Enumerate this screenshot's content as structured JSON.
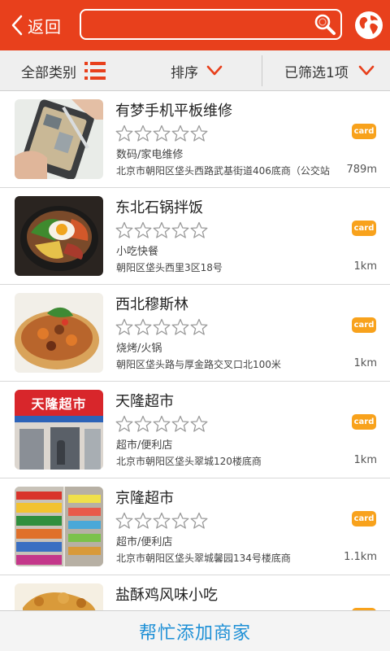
{
  "colors": {
    "brand": "#e8401c",
    "badge": "#f8a21c",
    "link": "#1e90d6"
  },
  "topbar": {
    "back_label": "返回",
    "search_placeholder": "",
    "search_value": "",
    "icons": {
      "back": "chevron-left-icon",
      "search": "search-icon",
      "globe": "globe-icon"
    }
  },
  "filters": {
    "all_categories": "全部类别",
    "sort": "排序",
    "selected": "已筛选1项",
    "icons": {
      "list": "list-icon",
      "dropdown": "chevron-down-icon"
    }
  },
  "items": [
    {
      "name": "有梦手机平板维修",
      "rating": 0,
      "category": "数码/家电维修",
      "address": "北京市朝阳区垡头西路武基街道406底商（公交站",
      "distance": "789m",
      "badge": "card",
      "thumb": "phone-repair"
    },
    {
      "name": "东北石锅拌饭",
      "rating": 0,
      "category": "小吃快餐",
      "address": "朝阳区垡头西里3区18号",
      "distance": "1km",
      "badge": "card",
      "thumb": "bibimbap"
    },
    {
      "name": "西北穆斯林",
      "rating": 0,
      "category": "烧烤/火锅",
      "address": "朝阳区垡头路与厚金路交叉口北100米",
      "distance": "1km",
      "badge": "card",
      "thumb": "pizza"
    },
    {
      "name": "天隆超市",
      "rating": 0,
      "category": "超市/便利店",
      "address": "北京市朝阳区垡头翠城120楼底商",
      "distance": "1km",
      "badge": "card",
      "thumb": "storefront",
      "thumb_text": "天隆超市"
    },
    {
      "name": "京隆超市",
      "rating": 0,
      "category": "超市/便利店",
      "address": "北京市朝阳区垡头翠城馨园134号楼底商",
      "distance": "1.1km",
      "badge": "card",
      "thumb": "supermarket-shelves"
    },
    {
      "name": "盐酥鸡风味小吃",
      "rating": 0,
      "category": "",
      "address": "",
      "distance": "",
      "badge": "card",
      "thumb": "fried-chicken"
    }
  ],
  "bottom": {
    "add_merchant": "帮忙添加商家"
  }
}
